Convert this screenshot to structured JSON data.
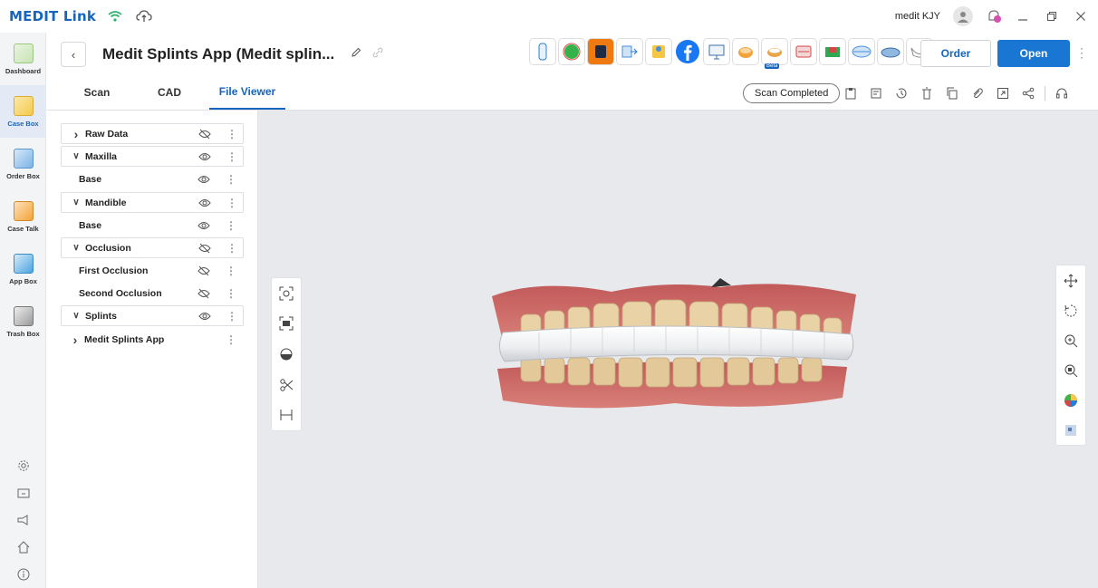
{
  "app": {
    "brand": "MEDIT Link",
    "user": "medit KJY"
  },
  "sidebar": {
    "items": [
      {
        "label": "Dashboard",
        "color": "#6aa84f"
      },
      {
        "label": "Case Box",
        "color": "#f2c94c"
      },
      {
        "label": "Order Box",
        "color": "#4a90d9"
      },
      {
        "label": "Case Talk",
        "color": "#f2a33a"
      },
      {
        "label": "App Box",
        "color": "#4aa3df"
      },
      {
        "label": "Trash Box",
        "color": "#777777"
      }
    ]
  },
  "case": {
    "title": "Medit Splints App (Medit splin...",
    "order_label": "Order",
    "open_label": "Open",
    "app_beta_label": "Beta"
  },
  "tabs": [
    {
      "label": "Scan"
    },
    {
      "label": "CAD"
    },
    {
      "label": "File Viewer"
    }
  ],
  "status_chip": "Scan Completed",
  "tree": [
    {
      "label": "Raw Data",
      "chevron": ">",
      "eye": "hidden",
      "boxed": true
    },
    {
      "label": "Maxilla",
      "chevron": "v",
      "eye": "visible",
      "boxed": true
    },
    {
      "label": "Base",
      "chevron": "",
      "eye": "visible",
      "boxed": false
    },
    {
      "label": "Mandible",
      "chevron": "v",
      "eye": "visible",
      "boxed": true
    },
    {
      "label": "Base",
      "chevron": "",
      "eye": "visible",
      "boxed": false
    },
    {
      "label": "Occlusion",
      "chevron": "v",
      "eye": "hidden",
      "boxed": true
    },
    {
      "label": "First Occlusion",
      "chevron": "",
      "eye": "hidden",
      "boxed": false
    },
    {
      "label": "Second Occlusion",
      "chevron": "",
      "eye": "hidden",
      "boxed": false
    },
    {
      "label": "Splints",
      "chevron": "v",
      "eye": "visible",
      "boxed": true
    },
    {
      "label": "Medit Splints App",
      "chevron": ">",
      "eye": "",
      "boxed": false
    }
  ]
}
